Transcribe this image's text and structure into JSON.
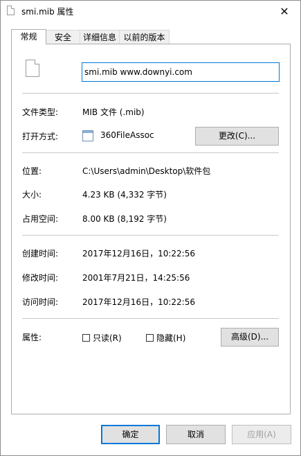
{
  "window": {
    "title": "smi.mib 属性",
    "close_glyph": "✕"
  },
  "tabs": [
    {
      "label": "常规",
      "active": true
    },
    {
      "label": "安全",
      "active": false
    },
    {
      "label": "详细信息",
      "active": false
    },
    {
      "label": "以前的版本",
      "active": false
    }
  ],
  "general": {
    "file_icon": "document-icon",
    "name_value": "smi.mib www.downyi.com",
    "file_type_label": "文件类型:",
    "file_type_value": "MIB 文件 (.mib)",
    "open_with_label": "打开方式:",
    "open_with_value": "360FileAssoc",
    "open_with_icon": "app-window-icon",
    "change_button": "更改(C)...",
    "location_label": "位置:",
    "location_value": "C:\\Users\\admin\\Desktop\\软件包",
    "size_label": "大小:",
    "size_value": "4.23 KB (4,332 字节)",
    "size_on_disk_label": "占用空间:",
    "size_on_disk_value": "8.00 KB (8,192 字节)",
    "created_label": "创建时间:",
    "created_value": "2017年12月16日，10:22:56",
    "modified_label": "修改时间:",
    "modified_value": "2001年7月21日，14:25:56",
    "accessed_label": "访问时间:",
    "accessed_value": "2017年12月16日，10:22:56",
    "attributes_label": "属性:",
    "readonly_label": "只读(R)",
    "readonly_checked": false,
    "hidden_label": "隐藏(H)",
    "hidden_checked": false,
    "advanced_button": "高级(D)..."
  },
  "footer": {
    "ok_button": "确定",
    "cancel_button": "取消",
    "apply_button": "应用(A)"
  },
  "colors": {
    "focus_accent": "#0078d7",
    "button_face": "#e1e1e1",
    "separator": "#c8c8c8"
  }
}
